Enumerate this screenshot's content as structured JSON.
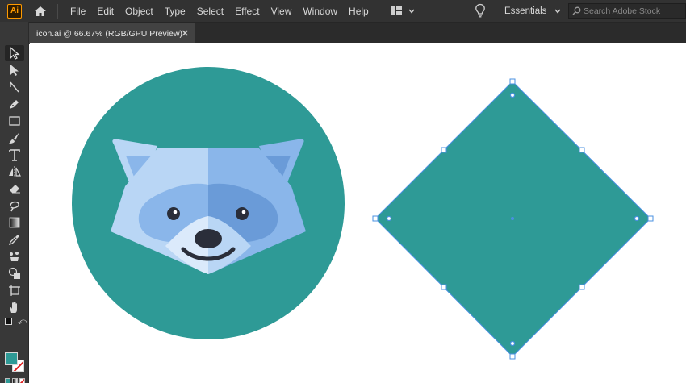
{
  "app": {
    "logo_text": "Ai"
  },
  "menu": [
    "File",
    "Edit",
    "Object",
    "Type",
    "Select",
    "Effect",
    "View",
    "Window",
    "Help"
  ],
  "workspace": {
    "label": "Essentials"
  },
  "search": {
    "placeholder": "Search Adobe Stock"
  },
  "document_tab": {
    "title": "icon.ai @ 66.67% (RGB/GPU Preview)",
    "close_glyph": "✕"
  },
  "colors": {
    "teal": "#2e9a96",
    "selection": "#4a90e2",
    "raccoon_light": "#b9d6f5",
    "raccoon_mid": "#8ab6ea",
    "raccoon_dark": "#6a9bd8",
    "raccoon_face_light": "#dbeafb",
    "raccoon_nose": "#2a2e3a"
  },
  "tools": [
    "selection-tool",
    "direct-selection-tool",
    "anchor-tool",
    "pen-tool",
    "rectangle-tool",
    "paintbrush-tool",
    "type-tool",
    "reflect-tool",
    "eraser-tool",
    "warp-tool",
    "gradient-tool",
    "eyedropper-tool",
    "puppet-warp-tool",
    "shape-builder-tool",
    "artboard-tool",
    "hand-tool"
  ]
}
